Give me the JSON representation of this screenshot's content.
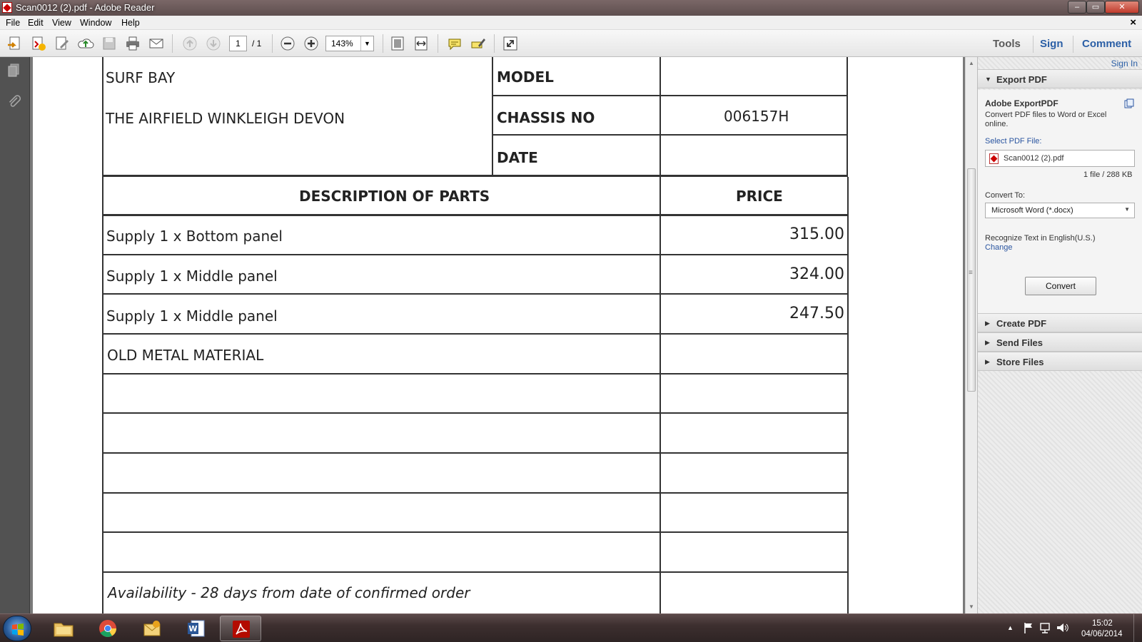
{
  "window": {
    "title": "Scan0012 (2).pdf - Adobe Reader",
    "min_glyph": "–",
    "max_glyph": "▭",
    "close_glyph": "✕"
  },
  "menu": {
    "items": [
      "File",
      "Edit",
      "View",
      "Window",
      "Help"
    ],
    "close_glyph": "×"
  },
  "toolbar": {
    "page_current": "1",
    "page_total": "/ 1",
    "zoom": "143%",
    "tools_label": "Tools",
    "sign_label": "Sign",
    "comment_label": "Comment"
  },
  "document": {
    "address_line1": "SURF BAY",
    "address_line2": "THE AIRFIELD WINKLEIGH DEVON",
    "model_label": "MODEL",
    "chassis_label": "CHASSIS NO",
    "chassis_value": "006157H",
    "date_label": "DATE",
    "desc_header": "DESCRIPTION OF PARTS",
    "price_header": "PRICE",
    "rows": [
      {
        "description": "Supply 1 x Bottom panel",
        "price": "315.00"
      },
      {
        "description": "Supply 1 x Middle panel",
        "price": "324.00"
      },
      {
        "description": "Supply 1 x Middle panel",
        "price": "247.50"
      },
      {
        "description": "OLD METAL MATERIAL",
        "price": ""
      }
    ],
    "footer_note": "Availability - 28 days from date of confirmed order"
  },
  "right_panel": {
    "sign_in": "Sign In",
    "export_pdf_header": "Export PDF",
    "service_name": "Adobe ExportPDF",
    "service_desc": "Convert PDF files to Word or Excel online.",
    "select_label": "Select PDF File:",
    "file_name": "Scan0012 (2).pdf",
    "file_info": "1 file / 288 KB",
    "convert_to_label": "Convert To:",
    "convert_to_value": "Microsoft Word (*.docx)",
    "recognize_text": "Recognize Text in English(U.S.)",
    "change_link": "Change",
    "convert_button": "Convert",
    "create_pdf": "Create PDF",
    "send_files": "Send Files",
    "store_files": "Store Files"
  },
  "taskbar": {
    "time": "15:02",
    "date": "04/06/2014"
  },
  "icons": {
    "collapse": "▼",
    "expand": "▶"
  }
}
